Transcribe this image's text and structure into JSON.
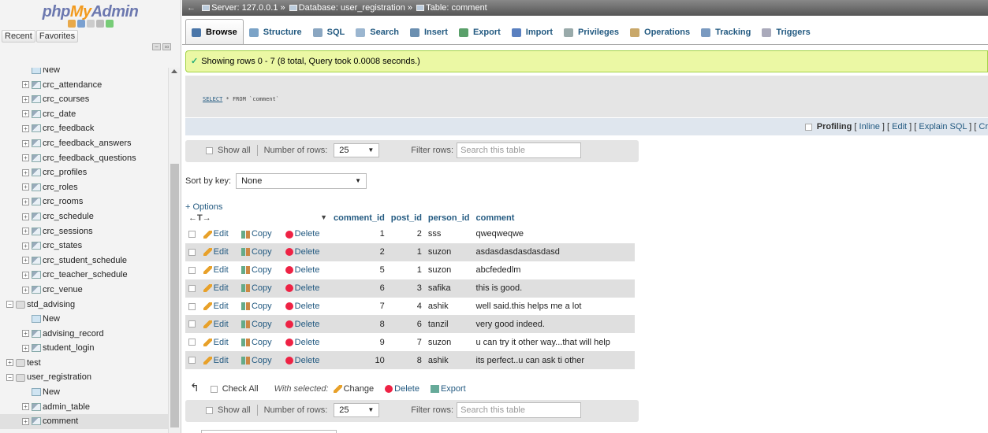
{
  "nav": {
    "logo_php": "php",
    "logo_my": "My",
    "logo_admin": "Admin",
    "tab_recent": "Recent",
    "tab_favorites": "Favorites",
    "tree": [
      {
        "label": "New",
        "level": "l2",
        "icon": "new"
      },
      {
        "label": "crc_attendance",
        "level": "l2",
        "icon": "table"
      },
      {
        "label": "crc_courses",
        "level": "l2",
        "icon": "table"
      },
      {
        "label": "crc_date",
        "level": "l2",
        "icon": "table"
      },
      {
        "label": "crc_feedback",
        "level": "l2",
        "icon": "table"
      },
      {
        "label": "crc_feedback_answers",
        "level": "l2",
        "icon": "table"
      },
      {
        "label": "crc_feedback_questions",
        "level": "l2",
        "icon": "table"
      },
      {
        "label": "crc_profiles",
        "level": "l2",
        "icon": "table"
      },
      {
        "label": "crc_roles",
        "level": "l2",
        "icon": "table"
      },
      {
        "label": "crc_rooms",
        "level": "l2",
        "icon": "table"
      },
      {
        "label": "crc_schedule",
        "level": "l2",
        "icon": "table"
      },
      {
        "label": "crc_sessions",
        "level": "l2",
        "icon": "table"
      },
      {
        "label": "crc_states",
        "level": "l2",
        "icon": "table"
      },
      {
        "label": "crc_student_schedule",
        "level": "l2",
        "icon": "table"
      },
      {
        "label": "crc_teacher_schedule",
        "level": "l2",
        "icon": "table"
      },
      {
        "label": "crc_venue",
        "level": "l2",
        "icon": "table"
      },
      {
        "label": "std_advising",
        "level": "l1",
        "icon": "db"
      },
      {
        "label": "New",
        "level": "l2",
        "icon": "new"
      },
      {
        "label": "advising_record",
        "level": "l2",
        "icon": "table"
      },
      {
        "label": "student_login",
        "level": "l2",
        "icon": "table"
      },
      {
        "label": "test",
        "level": "l1",
        "icon": "db"
      },
      {
        "label": "user_registration",
        "level": "l1",
        "icon": "db"
      },
      {
        "label": "New",
        "level": "l2",
        "icon": "new"
      },
      {
        "label": "admin_table",
        "level": "l2",
        "icon": "table"
      },
      {
        "label": "comment",
        "level": "l2",
        "icon": "table",
        "active": true
      }
    ]
  },
  "breadcrumb": {
    "server": "Server: 127.0.0.1",
    "database": "Database: user_registration",
    "table": "Table: comment",
    "separator": "»"
  },
  "tabs": [
    {
      "label": "Browse",
      "icon": "browse-icon",
      "color": "#4a76a8",
      "active": true
    },
    {
      "label": "Structure",
      "icon": "structure-icon",
      "color": "#7ba3c7"
    },
    {
      "label": "SQL",
      "icon": "sql-icon",
      "color": "#8aa6c1"
    },
    {
      "label": "Search",
      "icon": "search-icon",
      "color": "#9bb6d0"
    },
    {
      "label": "Insert",
      "icon": "insert-icon",
      "color": "#6b8fb0"
    },
    {
      "label": "Export",
      "icon": "export-icon",
      "color": "#5aa06a"
    },
    {
      "label": "Import",
      "icon": "import-icon",
      "color": "#5a80c0"
    },
    {
      "label": "Privileges",
      "icon": "privileges-icon",
      "color": "#9aa"
    },
    {
      "label": "Operations",
      "icon": "operations-icon",
      "color": "#c9a86a"
    },
    {
      "label": "Tracking",
      "icon": "tracking-icon",
      "color": "#7a9ac0"
    },
    {
      "label": "Triggers",
      "icon": "triggers-icon",
      "color": "#aab"
    }
  ],
  "success_msg": "Showing rows 0 - 7 (8 total, Query took 0.0008 seconds.)",
  "sql": {
    "kw": "SELECT",
    "rest": " * FROM `comment`"
  },
  "profiling": {
    "label": "Profiling",
    "inline": "Inline",
    "edit": "Edit",
    "explain": "Explain SQL",
    "more": "Cr"
  },
  "navbar": {
    "show_all": "Show all",
    "num_rows_label": "Number of rows:",
    "num_rows_value": "25",
    "filter_label": "Filter rows:",
    "filter_placeholder": "Search this table"
  },
  "sort_by": {
    "label": "Sort by key:",
    "value": "None"
  },
  "options_label": "+ Options",
  "grid": {
    "arrows": "←T→",
    "headers": [
      "comment_id",
      "post_id",
      "person_id",
      "comment"
    ],
    "action_edit": "Edit",
    "action_copy": "Copy",
    "action_delete": "Delete",
    "rows": [
      {
        "comment_id": "1",
        "post_id": "2",
        "person_id": "sss",
        "comment": "qweqweqwe"
      },
      {
        "comment_id": "2",
        "post_id": "1",
        "person_id": "suzon",
        "comment": "asdasdasdasdasdasd"
      },
      {
        "comment_id": "5",
        "post_id": "1",
        "person_id": "suzon",
        "comment": "abcfededlm"
      },
      {
        "comment_id": "6",
        "post_id": "3",
        "person_id": "safika",
        "comment": "this is good."
      },
      {
        "comment_id": "7",
        "post_id": "4",
        "person_id": "ashik",
        "comment": "well said.this helps me a lot"
      },
      {
        "comment_id": "8",
        "post_id": "6",
        "person_id": "tanzil",
        "comment": "very good indeed."
      },
      {
        "comment_id": "9",
        "post_id": "7",
        "person_id": "suzon",
        "comment": "u can try it other way...that will help"
      },
      {
        "comment_id": "10",
        "post_id": "8",
        "person_id": "ashik",
        "comment": "its perfect..u can ask ti other"
      }
    ]
  },
  "bulk": {
    "check_all": "Check All",
    "with_selected": "With selected:",
    "change": "Change",
    "delete": "Delete",
    "export": "Export"
  }
}
